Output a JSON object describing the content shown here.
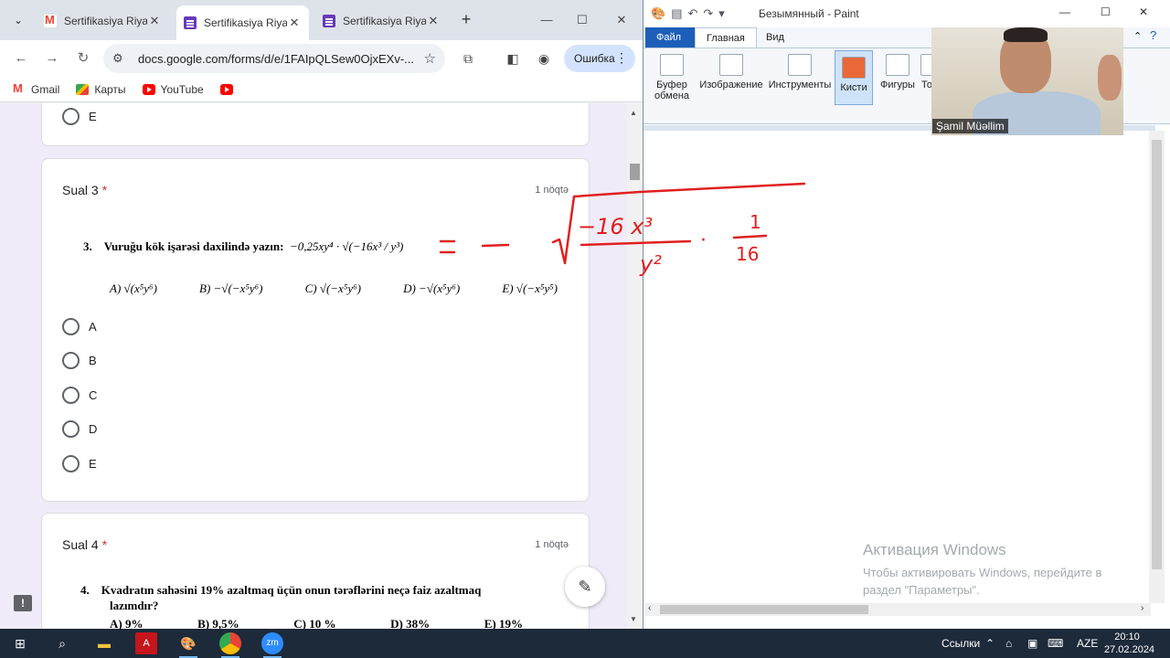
{
  "chrome": {
    "tabs": [
      {
        "title": "Sertifikasiya Riyaz",
        "favicon": "gmail-icon",
        "close": "✕"
      },
      {
        "title": "Sertifikasiya Riyaz",
        "favicon": "forms-icon",
        "close": "✕"
      },
      {
        "title": "Sertifikasiya Riyaz",
        "favicon": "forms-icon",
        "close": "✕"
      }
    ],
    "new_tab": "+",
    "url": "docs.google.com/forms/d/e/1FAIpQLSew0OjxEXv-...",
    "profile_label": "Ошибка",
    "bookmarks": [
      "Gmail",
      "Карты",
      "YouTube"
    ]
  },
  "form": {
    "prev_option": "E",
    "q3": {
      "title": "Sual 3",
      "required": "*",
      "points": "1 nöqtə",
      "number": "3.",
      "prompt": "Vuruğu kök işarəsi daxilində yazın:",
      "expr": "−0,25xy⁴ · √(−16x³ / y³)",
      "answers": [
        "A) √(x⁵y⁶)",
        "B) −√(−x⁵y⁶)",
        "C) √(−x⁵y⁶)",
        "D) −√(x⁵y⁶)",
        "E) √(−x⁵y⁵)"
      ],
      "options": [
        "A",
        "B",
        "C",
        "D",
        "E"
      ]
    },
    "q4": {
      "title": "Sual 4",
      "required": "*",
      "points": "1 nöqtə",
      "number": "4.",
      "prompt_line1": "Kvadratın  sahəsini  19%  azaltmaq üçün onun tərəflərini neçə faiz azaltmaq",
      "prompt_line2": "lazımdır?",
      "answers": [
        "A) 9%",
        "B) 9,5%",
        "C) 10 %",
        "D) 38%",
        "E) 19%"
      ]
    }
  },
  "paint": {
    "title": "Безымянный - Paint",
    "tabs": [
      "Файл",
      "Главная",
      "Вид"
    ],
    "groups": [
      "Буфер обмена",
      "Изображение",
      "Инструменты",
      "Кисти",
      "Фигуры",
      "То"
    ],
    "activation_title": "Активация Windows",
    "activation_line1": "Чтобы активировать Windows, перейдите в",
    "activation_line2": "раздел \"Параметры\"."
  },
  "ink": {
    "color": "#e02020",
    "equals": "=",
    "minus": "−",
    "numerator": "−16 x³",
    "denominator": "y²",
    "dot": "·",
    "fraction_top": "1",
    "fraction_bottom": "16"
  },
  "webcam": {
    "name": "Şamil Müəllim"
  },
  "taskbar": {
    "links_label": "Ссылки",
    "lang": "AZE",
    "time": "20:10",
    "date": "27.02.2024"
  }
}
